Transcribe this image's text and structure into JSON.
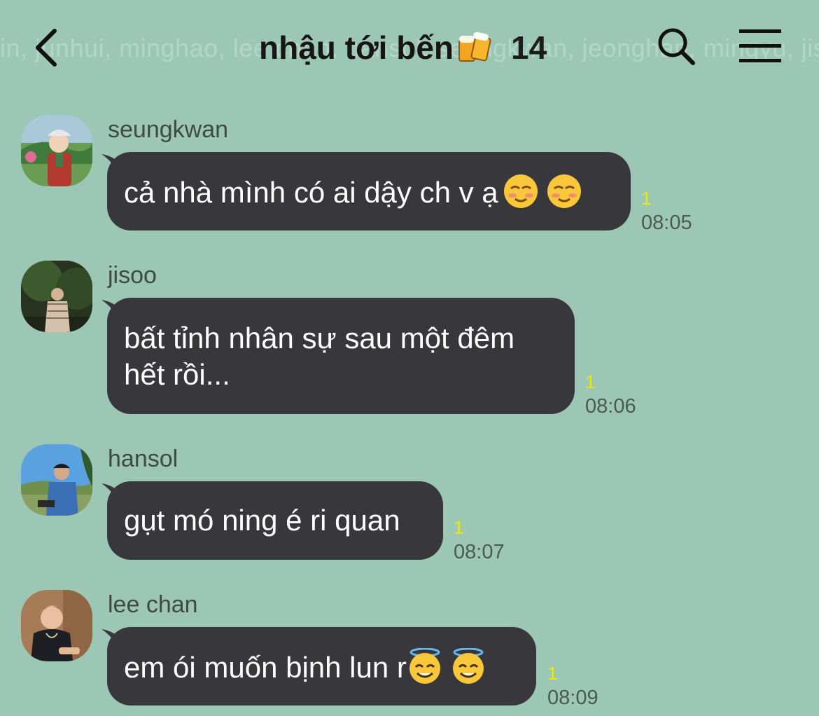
{
  "header": {
    "members_line": "in, junhui, minghao, lee chan, hansol, seungkwan, jeonghan, mingyu, jisoo, seungcheol, wonwoo, jihoon, soonyoung, seokmin",
    "title": "nhậu tới bến",
    "title_icon": "beer-mugs-icon",
    "member_count": "14",
    "icons": [
      "back-chevron-icon",
      "search-icon",
      "menu-icon"
    ]
  },
  "messages": [
    {
      "sender": "seungkwan",
      "text": "cả nhà mình có ai dậy ch v ạ",
      "emoji": [
        "smiling-face-icon",
        "smiling-face-icon"
      ],
      "unread": "1",
      "time": "08:05"
    },
    {
      "sender": "jisoo",
      "text": "bất tỉnh nhân sự sau một đêm\nhết rồi...",
      "emoji": [],
      "unread": "1",
      "time": "08:06"
    },
    {
      "sender": "hansol",
      "text": "gụt mó ning é ri quan",
      "emoji": [],
      "unread": "1",
      "time": "08:07"
    },
    {
      "sender": "lee chan",
      "text": "em ói muốn bịnh lun r",
      "emoji": [
        "halo-face-icon",
        "halo-face-icon"
      ],
      "unread": "1",
      "time": "08:09"
    }
  ],
  "colors": {
    "background": "#9dc7b5",
    "bubble": "#38373b",
    "unread": "#f2e600",
    "time": "#4a5a53"
  }
}
